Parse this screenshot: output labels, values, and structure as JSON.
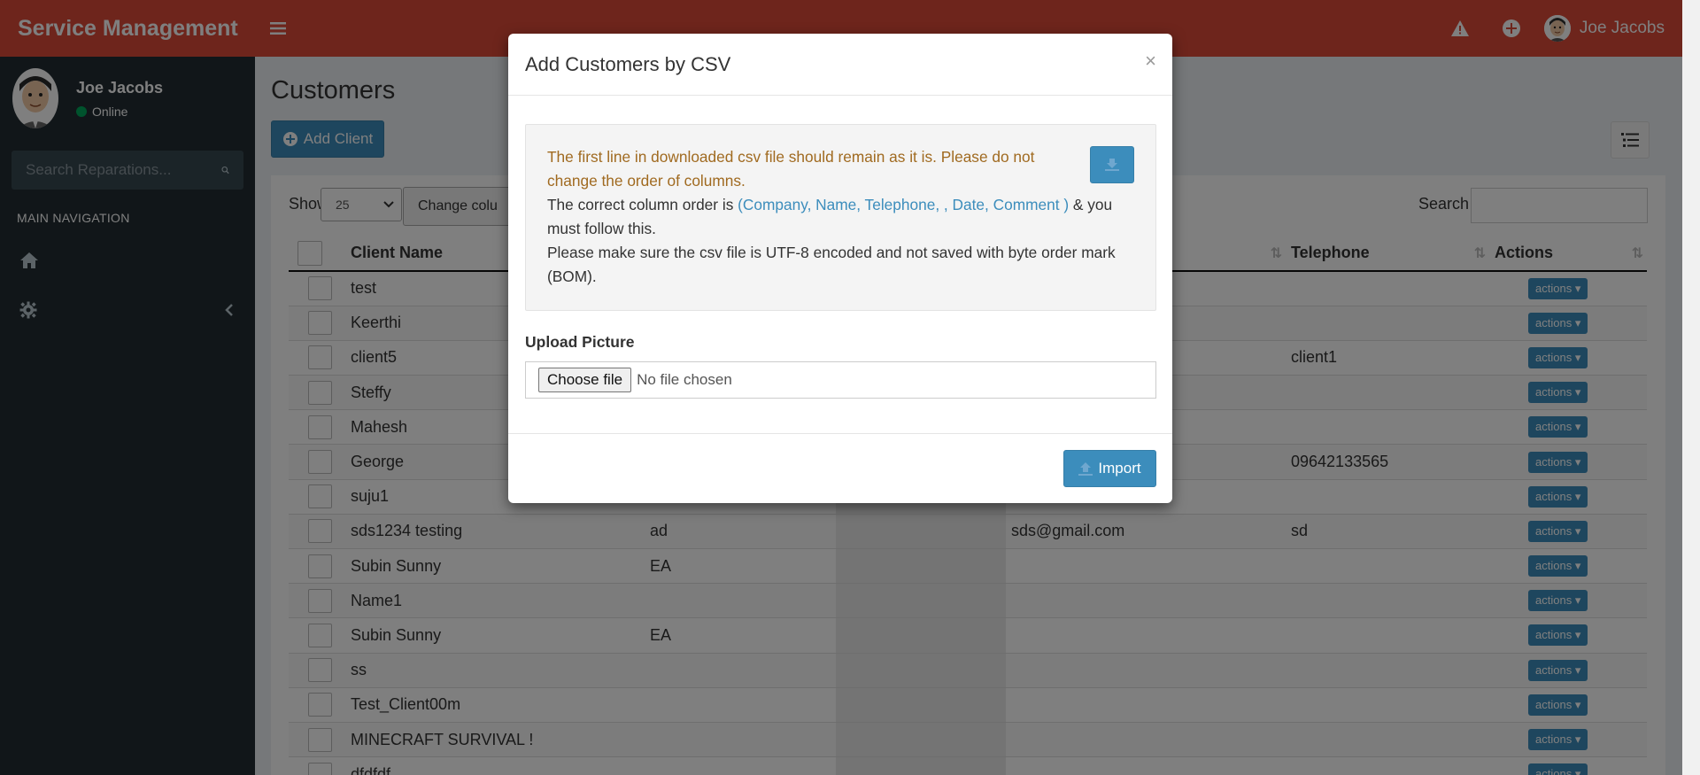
{
  "header": {
    "brand": "Service Management",
    "user_name": "Joe Jacobs"
  },
  "sidebar": {
    "user_name": "Joe Jacobs",
    "status": "Online",
    "search_placeholder": "Search Reparations...",
    "nav_header": "MAIN NAVIGATION",
    "items": [
      {
        "icon": "home-icon"
      },
      {
        "icon": "gear-icon"
      }
    ]
  },
  "page": {
    "title": "Customers",
    "add_button": "Add Client",
    "show_label": "Show",
    "page_size": "25",
    "change_columns": "Change colu",
    "search_label": "Search"
  },
  "table": {
    "columns": [
      "Client Name",
      "",
      "",
      "",
      "Telephone",
      "Actions"
    ],
    "rows": [
      {
        "name": "test",
        "c2": "",
        "c4": "",
        "tel": ""
      },
      {
        "name": "Keerthi",
        "c2": "",
        "c4": "",
        "tel": ""
      },
      {
        "name": "client5",
        "c2": "",
        "c4": "",
        "tel": "client1"
      },
      {
        "name": "Steffy",
        "c2": "",
        "c4": "",
        "tel": ""
      },
      {
        "name": "Mahesh",
        "c2": "",
        "c4": "",
        "tel": ""
      },
      {
        "name": "George",
        "c2": "",
        "c4": "",
        "tel": "09642133565"
      },
      {
        "name": "suju1",
        "c2": "",
        "c4": "",
        "tel": ""
      },
      {
        "name": "sds1234 testing",
        "c2": "ad",
        "c4": "sds@gmail.com",
        "tel": "sd"
      },
      {
        "name": "Subin Sunny",
        "c2": "EA",
        "c4": "",
        "tel": ""
      },
      {
        "name": "Name1",
        "c2": "",
        "c4": "",
        "tel": ""
      },
      {
        "name": "Subin Sunny",
        "c2": "EA",
        "c4": "",
        "tel": ""
      },
      {
        "name": "ss",
        "c2": "",
        "c4": "",
        "tel": ""
      },
      {
        "name": "Test_Client00m",
        "c2": "",
        "c4": "",
        "tel": ""
      },
      {
        "name": "MINECRAFT SURVIVAL !",
        "c2": "",
        "c4": "",
        "tel": ""
      },
      {
        "name": "dfdfdf",
        "c2": "",
        "c4": "",
        "tel": ""
      }
    ],
    "action_label": "actions"
  },
  "modal": {
    "title": "Add Customers by CSV",
    "close": "×",
    "warning": "The first line in downloaded csv file should remain as it is. Please do not change the order of columns.",
    "order_prefix": "The correct column order is ",
    "order_columns": "(Company, Name, Telephone, , Date, Comment )",
    "order_suffix": " & you must follow this.",
    "encoding_note": "Please make sure the csv file is UTF-8 encoded and not saved with byte order mark (BOM).",
    "upload_label": "Upload Picture",
    "choose_file": "Choose file",
    "no_file": "No file chosen",
    "import_button": "Import"
  }
}
